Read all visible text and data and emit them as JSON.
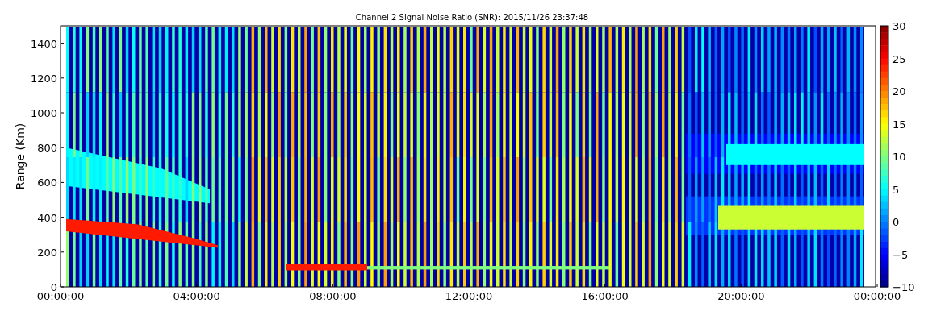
{
  "chart": {
    "title": "Channel 2 Signal Noise Ratio (SNR): 2015/11/26 23:37:48",
    "ylabel": "Range (Km)",
    "yticks": [
      "1400",
      "1200",
      "1000",
      "800",
      "600",
      "400",
      "200",
      "0"
    ],
    "xticks": [
      "00:00:00",
      "04:00:00",
      "08:00:00",
      "12:00:00",
      "16:00:00",
      "20:00:00",
      "00:00:00"
    ]
  },
  "colorbar": {
    "ticks": [
      "30",
      "25",
      "20",
      "15",
      "10",
      "5",
      "0",
      "−5",
      "−10"
    ]
  }
}
